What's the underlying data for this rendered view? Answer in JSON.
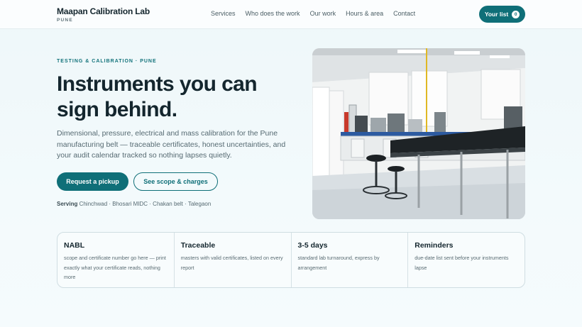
{
  "header": {
    "brand_name": "Maapan Calibration Lab",
    "brand_sub": "PUNE",
    "nav": [
      "Services",
      "Who does the work",
      "Our work",
      "Hours & area",
      "Contact"
    ],
    "cart_label": "Your list",
    "cart_count": "0"
  },
  "hero": {
    "eyebrow": "TESTING & CALIBRATION · PUNE",
    "headline": "Instruments you can sign behind.",
    "lede": "Dimensional, pressure, electrical and mass calibration for the Pune manufacturing belt — traceable certificates, honest uncertainties, and your audit calendar tracked so nothing lapses quietly.",
    "primary_button": "Request a pickup",
    "secondary_button": "See scope & charges",
    "serving_label": "Serving",
    "serving_areas": "Chinchwad · Bhosari MIDC · Chakan belt · Talegaon",
    "image_icon": "laboratory-photo"
  },
  "features": [
    {
      "title": "NABL",
      "text": "scope and certificate number go here — print exactly what your certificate reads, nothing more"
    },
    {
      "title": "Traceable",
      "text": "masters with valid certificates, listed on every report"
    },
    {
      "title": "3-5 days",
      "text": "standard lab turnaround, express by arrangement"
    },
    {
      "title": "Reminders",
      "text": "due-date list sent before your instruments lapse"
    }
  ],
  "colors": {
    "accent": "#0f6f78",
    "ink": "#14262e",
    "muted": "#566a72"
  }
}
